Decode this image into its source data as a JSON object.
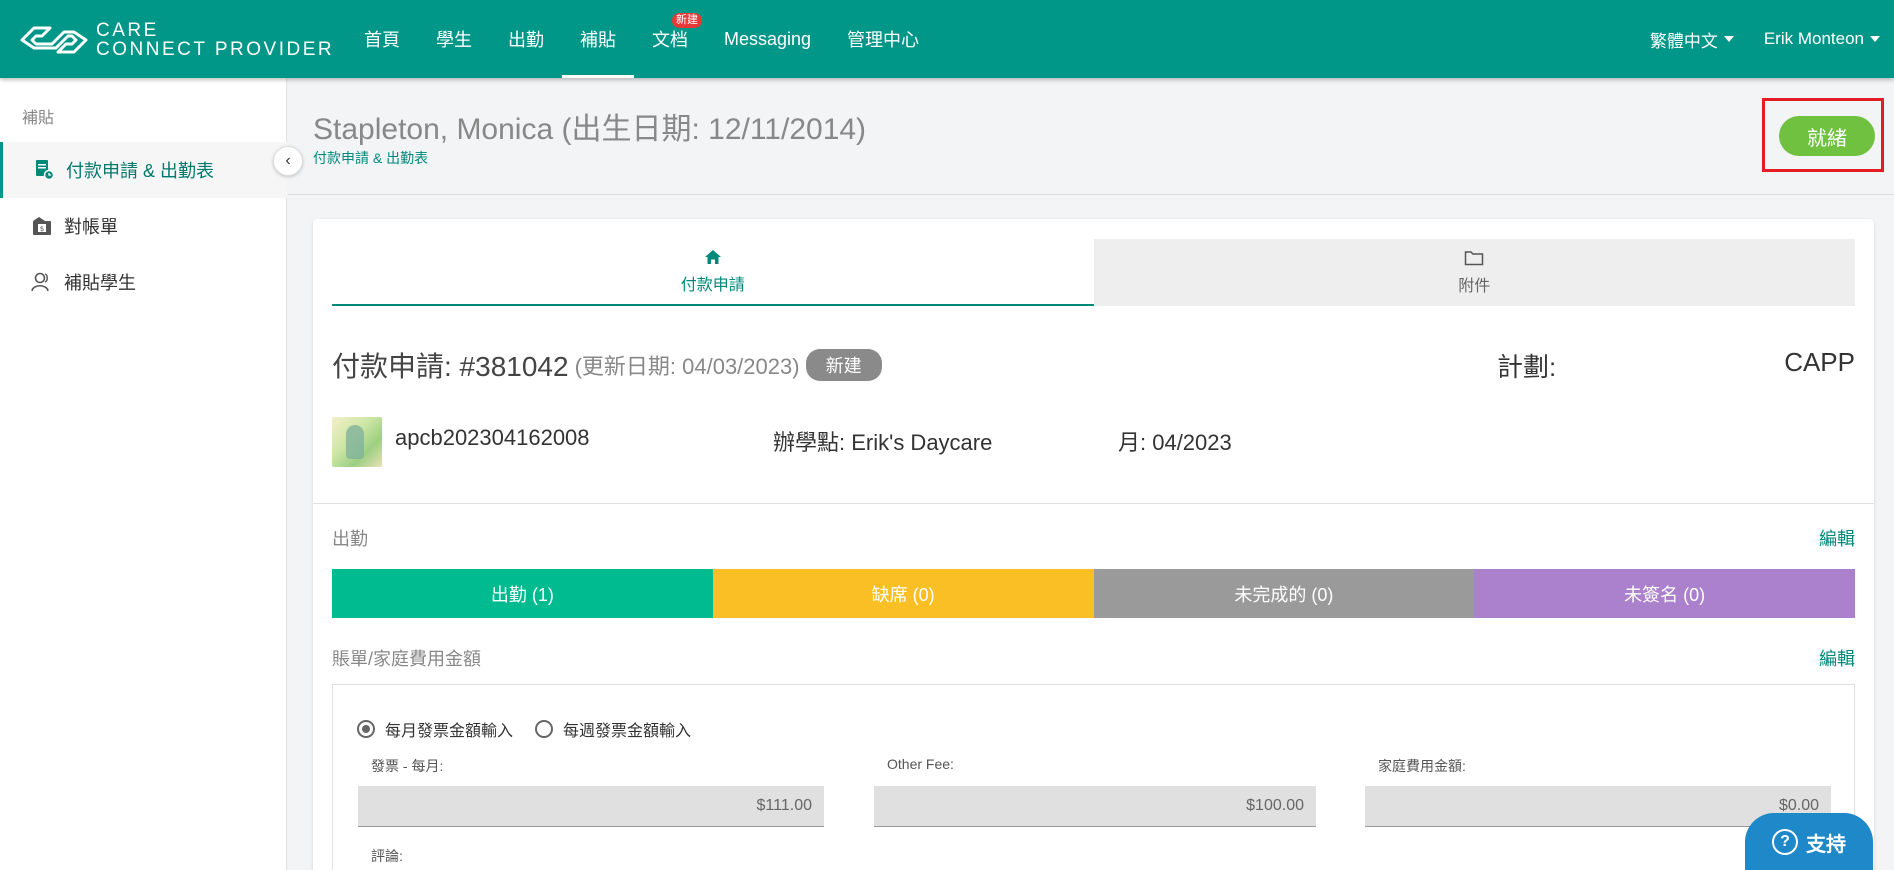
{
  "app": {
    "logo_line1": "CARE",
    "logo_line2": "CONNECT PROVIDER"
  },
  "nav": {
    "items": [
      {
        "label": "首頁"
      },
      {
        "label": "學生"
      },
      {
        "label": "出勤"
      },
      {
        "label": "補貼",
        "active": true
      },
      {
        "label": "文档",
        "badge": "新建"
      },
      {
        "label": "Messaging"
      },
      {
        "label": "管理中心"
      }
    ],
    "language": "繁體中文",
    "user": "Erik Monteon"
  },
  "sidebar": {
    "title": "補貼",
    "items": [
      {
        "label": "付款申請 & 出勤表",
        "icon": "document-clock-icon",
        "active": true
      },
      {
        "label": "對帳單",
        "icon": "money-folder-icon"
      },
      {
        "label": "補貼學生",
        "icon": "person-icon"
      }
    ]
  },
  "header": {
    "title": "Stapleton, Monica (出生日期: 12/11/2014)",
    "breadcrumb": "付款申請 & 出勤表",
    "ready_button": "就緒"
  },
  "tabs": [
    {
      "label": "付款申請",
      "icon": "home-icon",
      "active": true
    },
    {
      "label": "附件",
      "icon": "folder-icon",
      "active": false
    }
  ],
  "request": {
    "title": "付款申請: #381042",
    "updated": "(更新日期: 04/03/2023)",
    "status": "新建",
    "plan_label": "計劃:",
    "plan_value": "CAPP",
    "account": "apcb202304162008",
    "site": "辦學點: Erik's Daycare",
    "month": "月: 04/2023"
  },
  "attendance": {
    "label": "出勤",
    "edit": "編輯",
    "segments": [
      {
        "label": "出勤 (1)",
        "color": "#00bb8f"
      },
      {
        "label": "缺席 (0)",
        "color": "#fbbf26"
      },
      {
        "label": "未完成的 (0)",
        "color": "#9a9a9a"
      },
      {
        "label": "未簽名 (0)",
        "color": "#ab80cd"
      }
    ]
  },
  "fees": {
    "label": "賬單/家庭費用金額",
    "edit": "編輯",
    "radio_monthly": "每月發票金額輸入",
    "radio_weekly": "每週發票金額輸入",
    "invoice_label": "發票 - 每月:",
    "invoice_value": "$111.00",
    "other_label": "Other Fee:",
    "other_value": "$100.00",
    "family_label": "家庭費用金額:",
    "family_value": "$0.00",
    "comment_label": "評論:"
  },
  "support": {
    "label": "支持"
  },
  "colors": {
    "primary": "#009688",
    "ready": "#6fc13f",
    "highlight": "#e51c23",
    "support": "#1e88c8"
  }
}
